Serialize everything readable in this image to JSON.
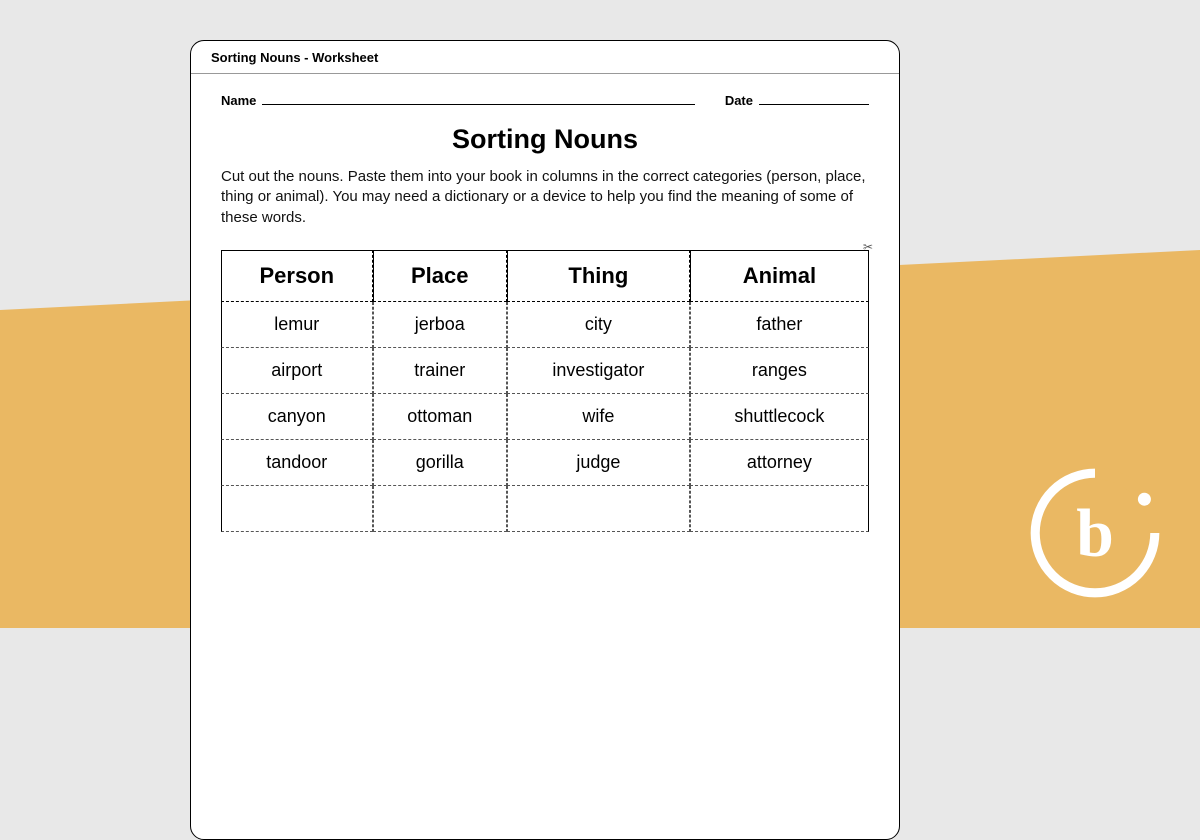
{
  "header": "Sorting Nouns - Worksheet",
  "labels": {
    "name": "Name",
    "date": "Date"
  },
  "title": "Sorting Nouns",
  "instructions": "Cut out the nouns. Paste them into your book in columns in the correct categories (person, place, thing or animal). You may need a dictionary or a device to help you find the meaning of some of these words.",
  "columns": [
    "Person",
    "Place",
    "Thing",
    "Animal"
  ],
  "rows": [
    [
      "lemur",
      "jerboa",
      "city",
      "father"
    ],
    [
      "airport",
      "trainer",
      "investigator",
      "ranges"
    ],
    [
      "canyon",
      "ottoman",
      "wife",
      "shuttlecock"
    ],
    [
      "tandoor",
      "gorilla",
      "judge",
      "attorney"
    ]
  ],
  "scissors_glyph": "✂"
}
